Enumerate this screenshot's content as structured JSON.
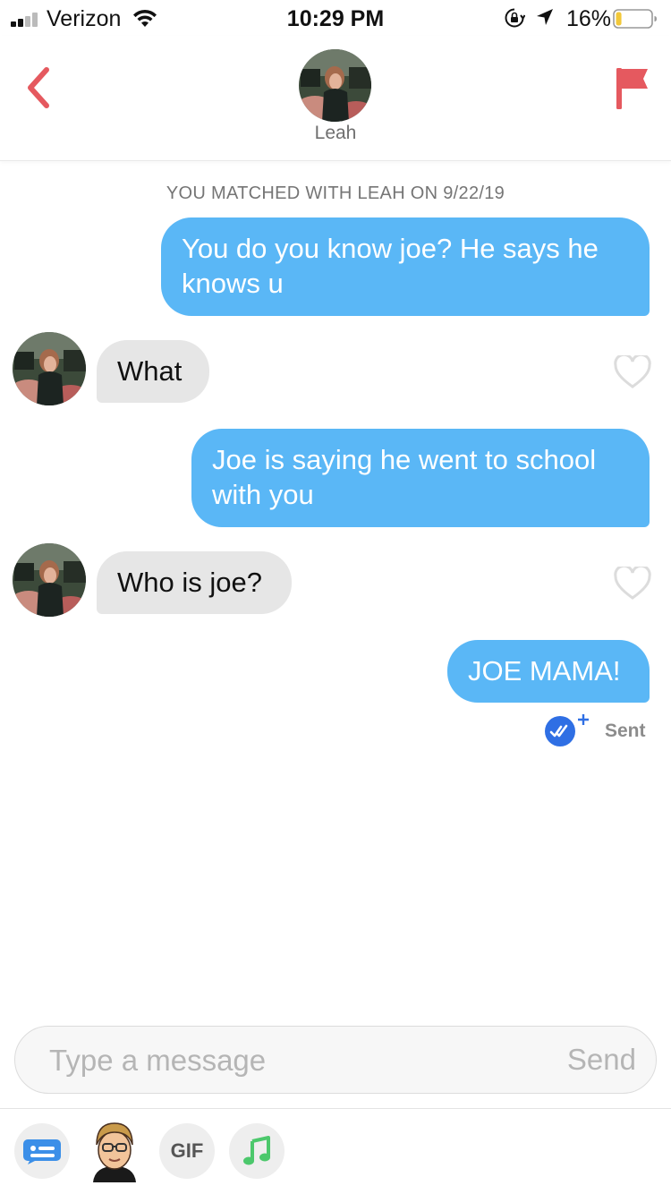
{
  "status_bar": {
    "carrier": "Verizon",
    "time": "10:29 PM",
    "battery_percent": "16%",
    "battery_level": 0.16,
    "icons": [
      "signal-icon",
      "wifi-icon",
      "rotation-lock-icon",
      "location-arrow-icon",
      "battery-icon"
    ]
  },
  "header": {
    "contact_name": "Leah",
    "back_icon": "chevron-left-icon",
    "report_icon": "flag-icon"
  },
  "conversation": {
    "match_notice": "YOU MATCHED WITH LEAH ON 9/22/19",
    "messages": [
      {
        "direction": "outgoing",
        "text": "You do you know joe? He says he knows u"
      },
      {
        "direction": "incoming",
        "text": "What"
      },
      {
        "direction": "outgoing",
        "text": "Joe is saying he went to school with you"
      },
      {
        "direction": "incoming",
        "text": "Who is joe?"
      },
      {
        "direction": "outgoing",
        "text": "JOE MAMA!"
      }
    ],
    "receipt_status": "Sent"
  },
  "composer": {
    "placeholder": "Type a message",
    "send_label": "Send"
  },
  "toolbar": {
    "gif_label": "GIF",
    "items": [
      "sticker-card-icon",
      "bitmoji-icon",
      "gif-button",
      "music-note-icon"
    ]
  },
  "colors": {
    "accent_red": "#e5595f",
    "outgoing_bubble": "#5ab7f6",
    "incoming_bubble": "#e6e6e6",
    "receipt_blue": "#2f6fe4",
    "music_green": "#4cc86c"
  }
}
